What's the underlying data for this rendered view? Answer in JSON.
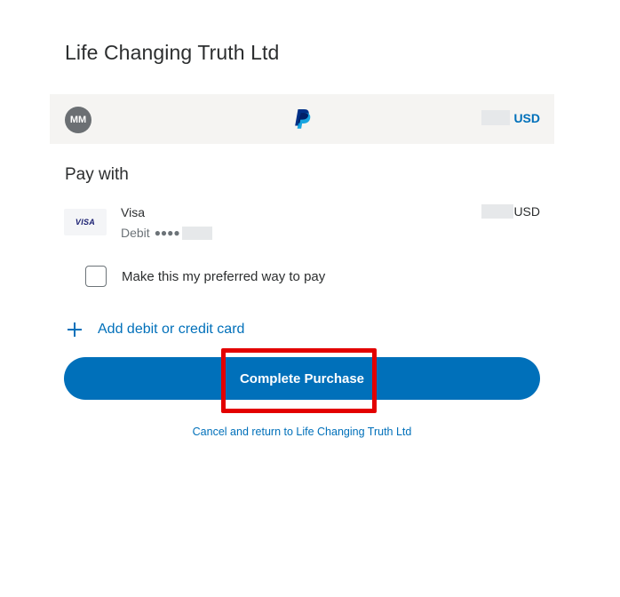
{
  "merchant": {
    "name": "Life Changing Truth Ltd"
  },
  "header": {
    "avatar_initials": "MM",
    "logo_icon": "paypal-logo-icon",
    "amount_currency": "USD"
  },
  "payment": {
    "section_title": "Pay with",
    "card": {
      "logo_text": "VISA",
      "brand": "Visa",
      "type_label": "Debit",
      "masked_dots": "●●●●",
      "currency": "USD"
    },
    "preferred_label": "Make this my preferred way to pay",
    "preferred_checked": false,
    "add_card_label": "Add debit or credit card"
  },
  "actions": {
    "complete_label": "Complete Purchase",
    "cancel_label": "Cancel and return to Life Changing Truth Ltd"
  },
  "colors": {
    "brand_blue": "#0070ba",
    "header_bg": "#f5f4f2",
    "highlight_red": "#e30000"
  }
}
